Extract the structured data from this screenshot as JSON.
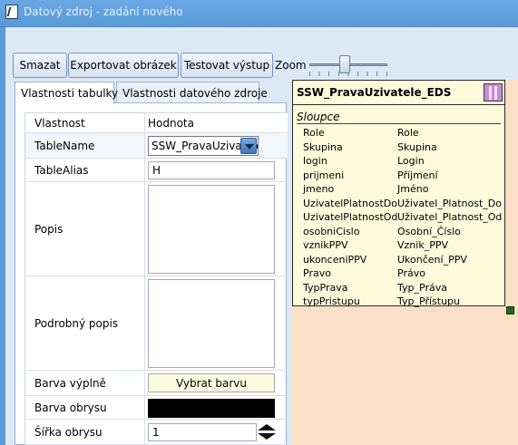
{
  "window": {
    "title": "Datový zdroj - zadání nového"
  },
  "toolbar": {
    "delete_label": "Smazat",
    "export_label": "Exportovat obrázek",
    "test_label": "Testovat výstup",
    "zoom_label": "Zoom",
    "zoom_level": 0.45
  },
  "tabs": [
    {
      "label": "Vlastnosti tabulky",
      "active": true
    },
    {
      "label": "Vlastnosti datového zdroje",
      "active": false
    }
  ],
  "properties": {
    "header": {
      "name": "Vlastnost",
      "value": "Hodnota"
    },
    "table_name": {
      "label": "TableName",
      "value": "SSW_PravaUzivatele_EDS"
    },
    "table_alias": {
      "label": "TableAlias",
      "value": "H"
    },
    "description": {
      "label": "Popis",
      "value": ""
    },
    "detailed_description": {
      "label": "Podrobný popis",
      "value": ""
    },
    "fill_color": {
      "label": "Barva výplně",
      "button_label": "Vybrat barvu",
      "color": "#fbfbe0"
    },
    "border_color": {
      "label": "Barva obrysu",
      "color": "#000000"
    },
    "border_width": {
      "label": "Šířka obrysu",
      "value": "1"
    }
  },
  "diagram": {
    "table_title": "SSW_PravaUzivatele_EDS",
    "section_label": "Sloupce",
    "columns": [
      {
        "name": "Role",
        "caption": "Role"
      },
      {
        "name": "Skupina",
        "caption": "Skupina"
      },
      {
        "name": "login",
        "caption": "Login"
      },
      {
        "name": "prijmeni",
        "caption": "Příjmení"
      },
      {
        "name": "jmeno",
        "caption": "Jméno"
      },
      {
        "name": "UzivatelPlatnostDo",
        "caption": "Uživatel_Platnost_Do"
      },
      {
        "name": "UzivatelPlatnostOd",
        "caption": "Uživatel_Platnost_Od"
      },
      {
        "name": "osobniCislo",
        "caption": "Osobní_Číslo"
      },
      {
        "name": "vznikPPV",
        "caption": "Vznik_PPV"
      },
      {
        "name": "ukonceniPPV",
        "caption": "Ukončení_PPV"
      },
      {
        "name": "Pravo",
        "caption": "Právo"
      },
      {
        "name": "TypPrava",
        "caption": "Typ_Práva"
      },
      {
        "name": "typPristupu",
        "caption": "Typ_Přístupu"
      }
    ],
    "colors": {
      "canvas": "#fbdfc7",
      "table_fill": "#fcfcdc",
      "icon": "#c98ad9",
      "handle": "#1c6b1c"
    }
  }
}
